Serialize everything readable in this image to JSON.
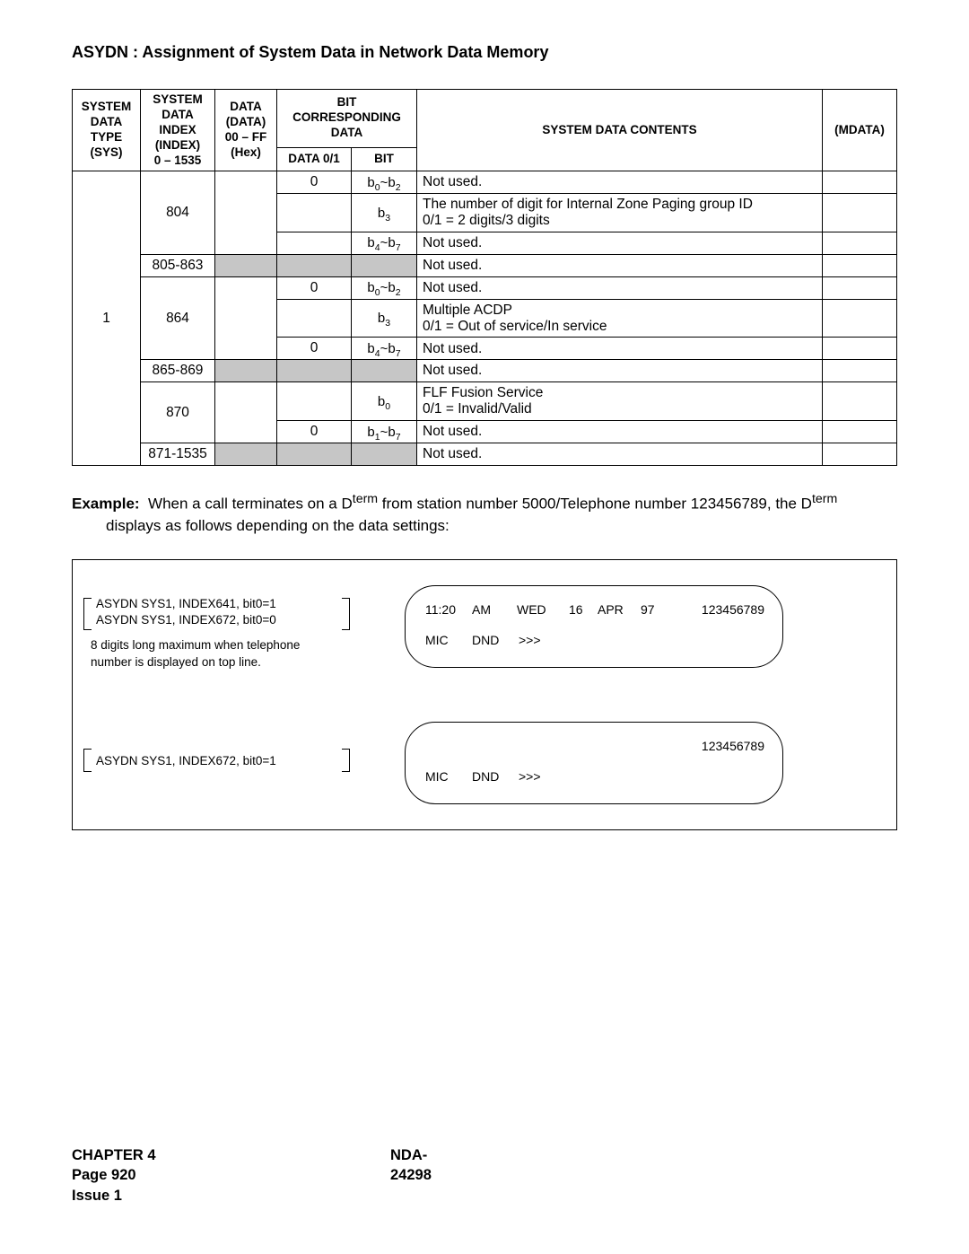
{
  "title": "ASYDN : Assignment of System Data in Network Data Memory",
  "table": {
    "headers": {
      "sys": "SYSTEM\nDATA\nTYPE\n(SYS)",
      "index": "SYSTEM\nDATA\nINDEX\n(INDEX)\n0 – 1535",
      "data": "DATA\n(DATA)\n00 – FF\n(Hex)",
      "bitgroup": "BIT\nCORRESPONDING\nDATA",
      "d01": "DATA 0/1",
      "bit": "BIT",
      "contents": "SYSTEM DATA CONTENTS",
      "mdata": "(MDATA)"
    },
    "sys_value": "1",
    "rows": [
      {
        "index": "804",
        "subrows": [
          {
            "d01": "0",
            "bit_html": "b<sub>0</sub>~b<sub>2</sub>",
            "contents": "Not used."
          },
          {
            "d01": "",
            "bit_html": "b<sub>3</sub>",
            "contents": "The number of digit for Internal Zone Paging group ID\n0/1 = 2 digits/3 digits"
          },
          {
            "d01": "",
            "bit_html": "b<sub>4</sub>~b<sub>7</sub>",
            "contents": "Not used."
          }
        ]
      },
      {
        "index": "805-863",
        "gray": true,
        "contents": "Not used."
      },
      {
        "index": "864",
        "subrows": [
          {
            "d01": "0",
            "bit_html": "b<sub>0</sub>~b<sub>2</sub>",
            "contents": "Not used."
          },
          {
            "d01": "",
            "bit_html": "b<sub>3</sub>",
            "contents": "Multiple ACDP\n0/1 = Out of service/In service"
          },
          {
            "d01": "0",
            "bit_html": "b<sub>4</sub>~b<sub>7</sub>",
            "contents": "Not used."
          }
        ]
      },
      {
        "index": "865-869",
        "gray": true,
        "contents": "Not used."
      },
      {
        "index": "870",
        "subrows": [
          {
            "d01": "",
            "bit_html": "b<sub>0</sub>",
            "contents": "FLF Fusion Service\n0/1 = Invalid/Valid"
          },
          {
            "d01": "0",
            "bit_html": "b<sub>1</sub>~b<sub>7</sub>",
            "contents": "Not used."
          }
        ]
      },
      {
        "index": "871-1535",
        "gray": true,
        "contents": "Not used."
      }
    ]
  },
  "example": {
    "label": "Example:",
    "line1_a": "When a call terminates on a D",
    "line1_sup": "term",
    "line1_b": " from station number 5000/Telephone number 123456789, the D",
    "line1_sup2": "term",
    "line2": "displays as follows depending on the data settings:"
  },
  "diagram": {
    "left_top_1": "ASYDN SYS1, INDEX641, bit0=1",
    "left_top_2": "ASYDN SYS1, INDEX672, bit0=0",
    "left_top_note": "8 digits long maximum when telephone\nnumber is displayed on top line.",
    "left_bottom": "ASYDN SYS1, INDEX672, bit0=1",
    "phone1_row1": [
      "11:20",
      "AM",
      "WED",
      "16",
      "APR",
      "97",
      "123456789"
    ],
    "phone1_row2": [
      "MIC",
      "DND",
      ">>>"
    ],
    "phone2_row1": [
      "",
      "",
      "",
      "",
      "",
      "",
      "123456789"
    ],
    "phone2_row2": [
      "MIC",
      "DND",
      ">>>"
    ]
  },
  "footer": {
    "chapter": "CHAPTER 4",
    "page": "Page 920",
    "issue": "Issue 1",
    "doc": "NDA-24298"
  }
}
